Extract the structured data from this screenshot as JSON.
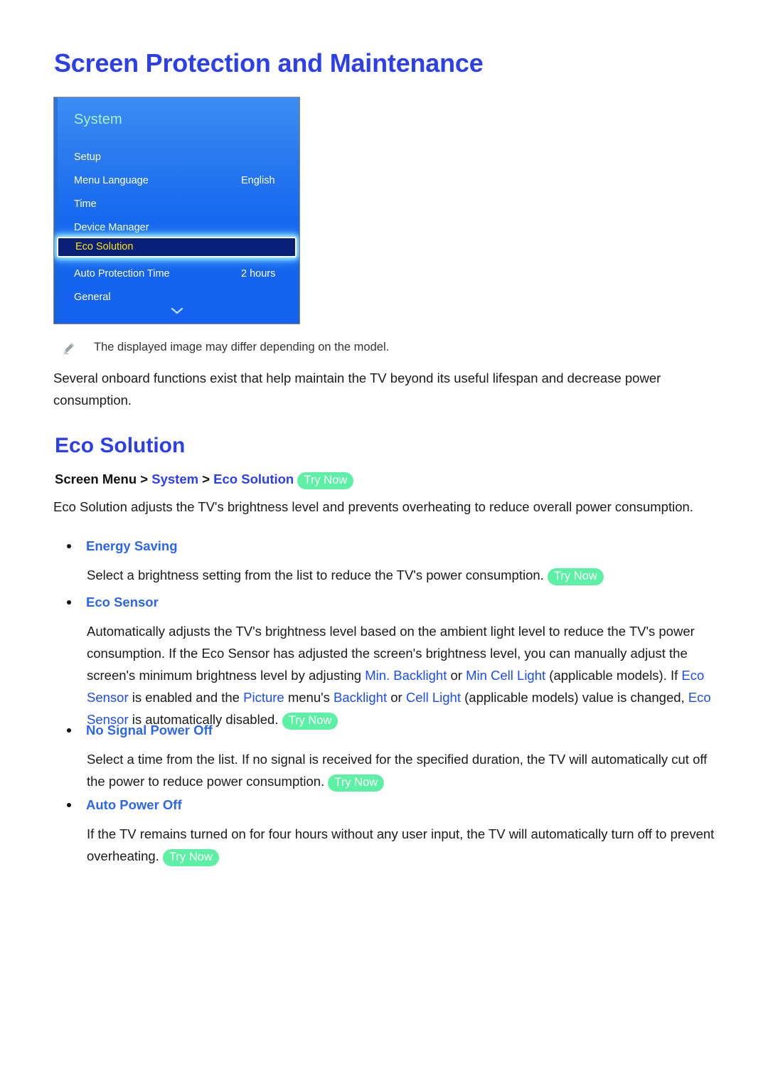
{
  "page": {
    "title": "Screen Protection and Maintenance"
  },
  "tv_menu": {
    "panel_title": "System",
    "scroll_icon": "chevron-down-icon",
    "rows": [
      {
        "label": "Setup",
        "value": ""
      },
      {
        "label": "Menu Language",
        "value": "English"
      },
      {
        "label": "Time",
        "value": ""
      },
      {
        "label": "Device Manager",
        "value": ""
      },
      {
        "label": "Eco Solution",
        "value": "",
        "selected": true
      },
      {
        "label": "Auto Protection Time",
        "value": "2 hours"
      },
      {
        "label": "General",
        "value": ""
      }
    ],
    "colors": {
      "panel_top": "#3c8ef5",
      "panel_bottom": "#1561ee",
      "title_text": "#a9f0b9",
      "selected_fill": "#0a1f78",
      "selected_text": "#ffe400",
      "selected_glow": "#a0f0ff"
    }
  },
  "note": {
    "icon": "pencil-icon",
    "text": "The displayed image may differ depending on the model."
  },
  "intro": {
    "text": "Several onboard functions exist that help maintain the TV beyond its useful lifespan and decrease power consumption."
  },
  "section": {
    "title": "Eco Solution",
    "breadcrumb": {
      "root": "Screen Menu",
      "sep": ">",
      "item1": "System",
      "item2": "Eco Solution",
      "try_now": "Try Now"
    },
    "description": "Eco Solution adjusts the TV's brightness level and prevents overheating to reduce overall power consumption."
  },
  "items": [
    {
      "title": "Energy Saving",
      "body_1": "Select a brightness setting from the list to reduce the TV's power consumption.",
      "try_now": "Try Now"
    },
    {
      "title": "Eco Sensor",
      "body_1": "Automatically adjusts the TV's brightness level based on the ambient light level to reduce the TV's power consumption. If the Eco Sensor has adjusted the screen's brightness level, you can manually adjust the screen's minimum brightness level by adjusting",
      "kw_1": "Min. Backlight",
      "body_2": "or",
      "kw_2": "Min Cell Light",
      "body_3": "(applicable models). If",
      "kw_3": "Eco Sensor",
      "body_4": "is enabled and the",
      "kw_4": "Picture",
      "body_5": "menu's",
      "kw_5": "Backlight",
      "body_6": "or",
      "kw_6": "Cell Light",
      "body_7": "(applicable models) value is changed,",
      "kw_7": "Eco Sensor",
      "body_8": "is automatically disabled.",
      "try_now": "Try Now"
    },
    {
      "title": "No Signal Power Off",
      "body_1": "Select a time from the list. If no signal is received for the specified duration, the TV will automatically cut off the power to reduce power consumption.",
      "try_now": "Try Now"
    },
    {
      "title": "Auto Power Off",
      "body_1": "If the TV remains turned on for four hours without any user input, the TV will automatically turn off to prevent overheating.",
      "try_now": "Try Now"
    }
  ],
  "colors": {
    "heading_blue": "#2b3fec",
    "keyword_blue": "#1a4df5",
    "trynow_green": "#5cf0a5",
    "body_black": "#1a1a1a"
  }
}
